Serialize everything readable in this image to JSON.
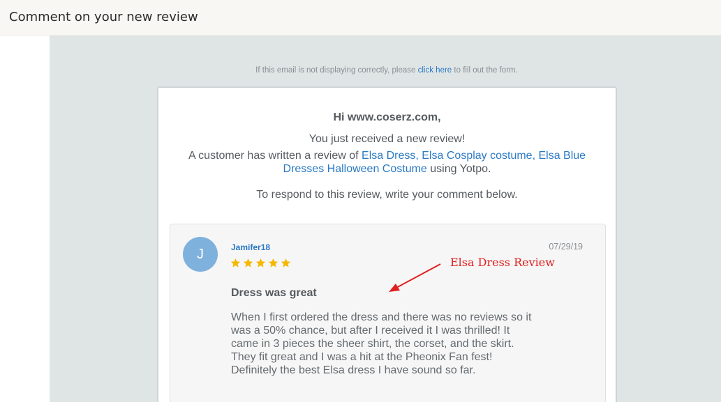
{
  "header": {
    "title": "Comment on your new review"
  },
  "notice": {
    "prefix": "If this email is not displaying correctly, please",
    "link": "click here",
    "suffix": "to fill out the form."
  },
  "email": {
    "greeting": "Hi www.coserz.com,",
    "received": "You just received a new review!",
    "desc_prefix": "A customer has written a review of",
    "product_link": "Elsa Dress, Elsa Cosplay costume, Elsa Blue Dresses Halloween Costume",
    "desc_suffix": "using Yotpo.",
    "respond": "To respond to this review, write your comment below."
  },
  "review": {
    "avatar_letter": "J",
    "username": "Jamifer18",
    "date": "07/29/19",
    "rating": 5,
    "title": "Dress was great",
    "body": "When I first ordered the dress and there was no reviews so it was a 50% chance, but after I received it I was thrilled! It came in 3 pieces the sheer shirt, the corset, and the skirt. They fit great and I was a hit at the Pheonix Fan fest! Definitely the best Elsa dress I have sound so far."
  },
  "annotation": {
    "text": "Elsa Dress Review"
  },
  "colors": {
    "link": "#2a79c4",
    "star": "#f5b800",
    "annotation": "#e02020",
    "avatar": "#7fb1dd"
  }
}
